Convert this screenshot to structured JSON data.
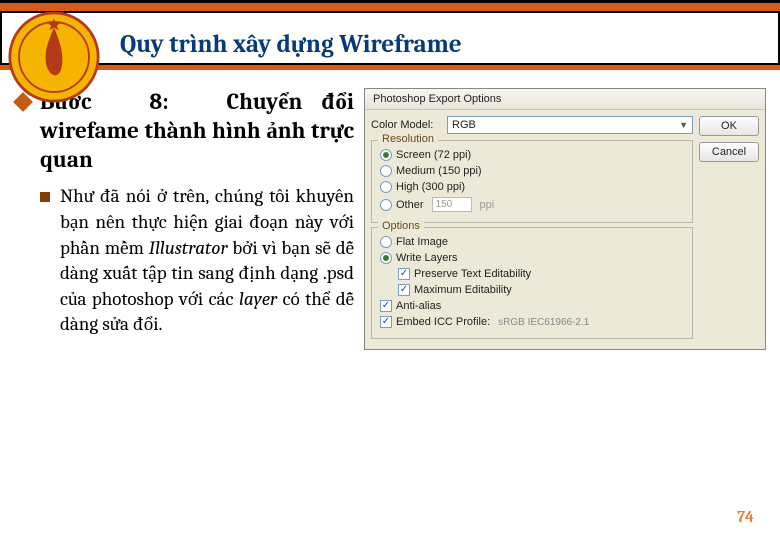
{
  "header": {
    "title": "Quy trình xây dựng Wireframe"
  },
  "step": {
    "prefix": "Bước",
    "num": "8:",
    "rest": "Chuyển đổi wirefame thành hình ảnh trực quan"
  },
  "bullet": {
    "t1": "Như đã nói ở trên, chúng tôi khuyên bạn nên thực hiện giai đoạn này với phần mềm ",
    "em": "Illustrator",
    "t2": " bởi vì bạn sẽ dễ dàng xuất tập tin sang định dạng .psd của photoshop với các ",
    "em2": "layer",
    "t3": " có thể dễ dàng sửa đổi."
  },
  "dialog": {
    "title": "Photoshop Export Options",
    "color_model_label": "Color Model:",
    "color_model_value": "RGB",
    "resolution_legend": "Resolution",
    "res_opts": {
      "screen": "Screen (72 ppi)",
      "medium": "Medium (150 ppi)",
      "high": "High (300 ppi)",
      "other": "Other",
      "other_val": "150",
      "ppi": "ppi"
    },
    "options_legend": "Options",
    "opts": {
      "flat": "Flat Image",
      "write": "Write Layers",
      "preserve": "Preserve Text Editability",
      "max": "Maximum Editability",
      "aa": "Anti-alias",
      "icc": "Embed ICC Profile:",
      "icc_val": "sRGB IEC61966-2.1"
    },
    "ok": "OK",
    "cancel": "Cancel"
  },
  "page_number": "74"
}
